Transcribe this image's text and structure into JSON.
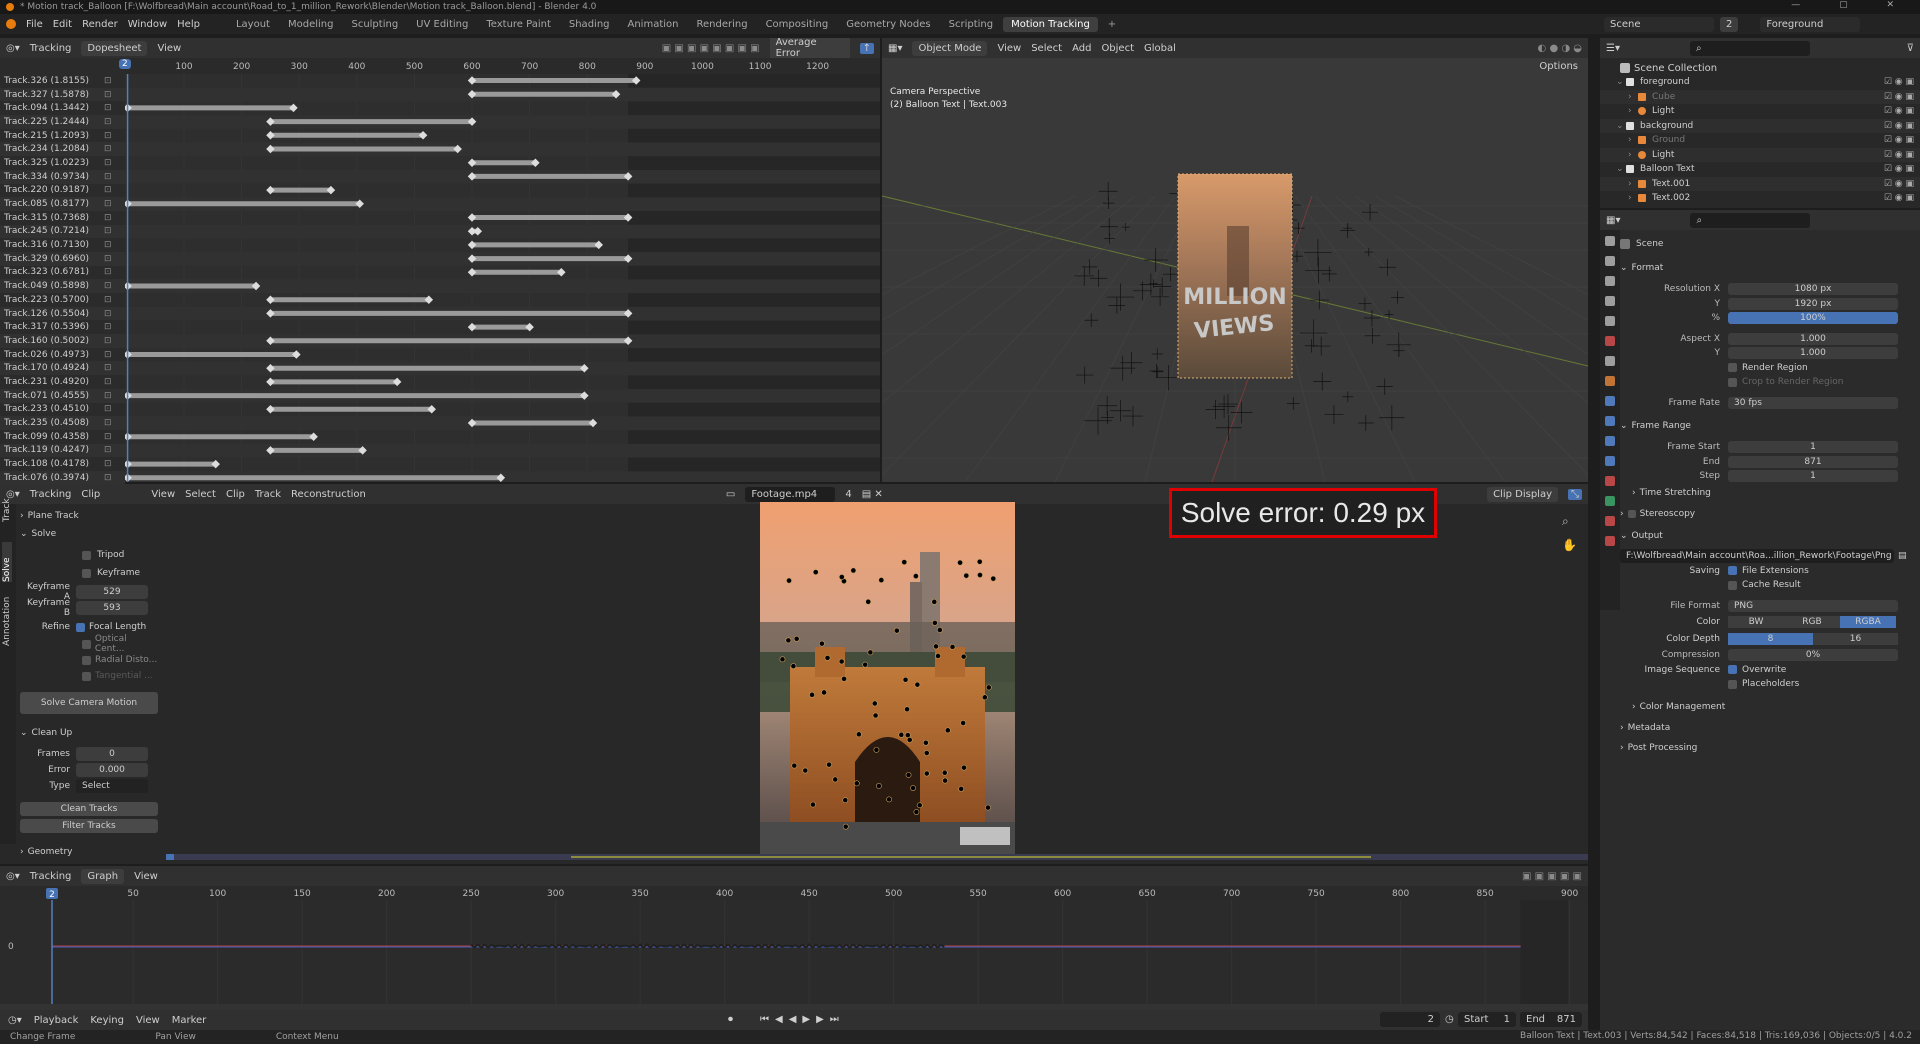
{
  "titlebar": {
    "title": "* Motion track_Balloon [F:\\Wolfbread\\Main account\\Road_to_1_million_Rework\\Blender\\Motion track_Balloon.blend] - Blender 4.0"
  },
  "menu": [
    "File",
    "Edit",
    "Render",
    "Window",
    "Help"
  ],
  "workspaces": [
    "Layout",
    "Modeling",
    "Sculpting",
    "UV Editing",
    "Texture Paint",
    "Shading",
    "Animation",
    "Rendering",
    "Compositing",
    "Geometry Nodes",
    "Scripting",
    "Motion Tracking"
  ],
  "active_workspace": "Motion Tracking",
  "scene_selector": {
    "scene": "Scene",
    "count": "2",
    "view_layer": "Foreground"
  },
  "dopesheet": {
    "mode": "Tracking",
    "view_type": "Dopesheet",
    "view_menu": "View",
    "sort": "Average Error",
    "current_frame": "2",
    "ruler": [
      "100",
      "200",
      "300",
      "400",
      "500",
      "600",
      "700",
      "800",
      "900",
      "1000",
      "1100",
      "1200"
    ],
    "tracks": [
      {
        "name": "Track.326 (1.8155)",
        "s": 600,
        "e": 885
      },
      {
        "name": "Track.327 (1.5878)",
        "s": 600,
        "e": 850
      },
      {
        "name": "Track.094 (1.3442)",
        "s": 2,
        "e": 290
      },
      {
        "name": "Track.225 (1.2444)",
        "s": 250,
        "e": 600
      },
      {
        "name": "Track.215 (1.2093)",
        "s": 250,
        "e": 515
      },
      {
        "name": "Track.234 (1.2084)",
        "s": 250,
        "e": 575
      },
      {
        "name": "Track.325 (1.0223)",
        "s": 600,
        "e": 710
      },
      {
        "name": "Track.334 (0.9734)",
        "s": 600,
        "e": 871
      },
      {
        "name": "Track.220 (0.9187)",
        "s": 250,
        "e": 355
      },
      {
        "name": "Track.085 (0.8177)",
        "s": 2,
        "e": 405
      },
      {
        "name": "Track.315 (0.7368)",
        "s": 600,
        "e": 871
      },
      {
        "name": "Track.245 (0.7214)",
        "s": 600,
        "e": 610
      },
      {
        "name": "Track.316 (0.7130)",
        "s": 600,
        "e": 820
      },
      {
        "name": "Track.329 (0.6960)",
        "s": 600,
        "e": 871
      },
      {
        "name": "Track.323 (0.6781)",
        "s": 600,
        "e": 755
      },
      {
        "name": "Track.049 (0.5898)",
        "s": 2,
        "e": 225
      },
      {
        "name": "Track.223 (0.5700)",
        "s": 250,
        "e": 525
      },
      {
        "name": "Track.126 (0.5504)",
        "s": 250,
        "e": 871
      },
      {
        "name": "Track.317 (0.5396)",
        "s": 600,
        "e": 700
      },
      {
        "name": "Track.160 (0.5002)",
        "s": 250,
        "e": 871
      },
      {
        "name": "Track.026 (0.4973)",
        "s": 2,
        "e": 295
      },
      {
        "name": "Track.170 (0.4924)",
        "s": 250,
        "e": 795
      },
      {
        "name": "Track.231 (0.4920)",
        "s": 250,
        "e": 470
      },
      {
        "name": "Track.071 (0.4555)",
        "s": 2,
        "e": 795
      },
      {
        "name": "Track.233 (0.4510)",
        "s": 250,
        "e": 530
      },
      {
        "name": "Track.235 (0.4508)",
        "s": 600,
        "e": 810
      },
      {
        "name": "Track.099 (0.4358)",
        "s": 2,
        "e": 325
      },
      {
        "name": "Track.119 (0.4247)",
        "s": 250,
        "e": 410
      },
      {
        "name": "Track.108 (0.4178)",
        "s": 2,
        "e": 155
      },
      {
        "name": "Track.076 (0.3974)",
        "s": 2,
        "e": 650
      }
    ]
  },
  "viewport": {
    "mode": "Object Mode",
    "menus": [
      "View",
      "Select",
      "Add",
      "Object"
    ],
    "transform": "Global",
    "options": "Options",
    "info_line1": "Camera Perspective",
    "info_line2": "(2) Balloon Text | Text.003",
    "text_line1": "MILLION",
    "text_line2": "VIEWS"
  },
  "clip_editor": {
    "mode": "Tracking",
    "view": "Clip",
    "menus": [
      "View",
      "Select",
      "Clip",
      "Track",
      "Reconstruction"
    ],
    "clip_name": "Footage.mp4",
    "clip_users": "4",
    "display": "Clip Display",
    "solve_error": "Solve error: 0.29 px"
  },
  "solve_panel": {
    "tabs": [
      "Track",
      "Solve",
      "Annotation"
    ],
    "plane_track": "Plane Track",
    "solve": "Solve",
    "tripod": "Tripod",
    "keyframe": "Keyframe",
    "keyframe_a_label": "Keyframe A",
    "keyframe_a": "529",
    "keyframe_b_label": "Keyframe B",
    "keyframe_b": "593",
    "refine": "Refine",
    "focal_length": "Focal Length",
    "optical_center": "Optical Cent...",
    "radial_distortion": "Radial Disto...",
    "tangential": "Tangential ...",
    "solve_button": "Solve Camera Motion",
    "clean_up": "Clean Up",
    "frames_label": "Frames",
    "frames": "0",
    "error_label": "Error",
    "error": "0.000",
    "type_label": "Type",
    "type": "Select",
    "clean_tracks": "Clean Tracks",
    "filter_tracks": "Filter Tracks",
    "geometry": "Geometry"
  },
  "graph": {
    "mode": "Tracking",
    "view_type": "Graph",
    "view_menu": "View",
    "current_frame": "2",
    "ruler": [
      "50",
      "100",
      "150",
      "200",
      "250",
      "300",
      "350",
      "400",
      "450",
      "500",
      "550",
      "600",
      "650",
      "700",
      "750",
      "800",
      "850",
      "900"
    ],
    "zero_label": "0"
  },
  "timeline": {
    "menus": [
      "Playback",
      "Keying",
      "View",
      "Marker"
    ],
    "frame": "2",
    "start_label": "Start",
    "start": "1",
    "end_label": "End",
    "end": "871"
  },
  "statusbar": {
    "hints": [
      "Change Frame",
      "Pan View",
      "Context Menu"
    ],
    "stats": "Balloon Text | Text.003 | Verts:84,542 | Faces:84,518 | Tris:169,036 | Objects:0/5 | 4.0.2"
  },
  "outliner": {
    "root": "Scene Collection",
    "items": [
      {
        "label": "foreground",
        "level": 1,
        "kind": "collection"
      },
      {
        "label": "Cube",
        "level": 2,
        "kind": "mesh",
        "dim": true
      },
      {
        "label": "Light",
        "level": 2,
        "kind": "light"
      },
      {
        "label": "background",
        "level": 1,
        "kind": "collection"
      },
      {
        "label": "Ground",
        "level": 2,
        "kind": "mesh",
        "dim": true
      },
      {
        "label": "Light",
        "level": 2,
        "kind": "light"
      },
      {
        "label": "Balloon Text",
        "level": 1,
        "kind": "collection"
      },
      {
        "label": "Text.001",
        "level": 2,
        "kind": "text"
      },
      {
        "label": "Text.002",
        "level": 2,
        "kind": "text"
      }
    ]
  },
  "properties": {
    "context": "Scene",
    "format": "Format",
    "resolution_x_label": "Resolution X",
    "resolution_x": "1080 px",
    "y_label": "Y",
    "resolution_y": "1920 px",
    "pct_label": "%",
    "pct": "100%",
    "aspect_x_label": "Aspect X",
    "aspect_x": "1.000",
    "aspect_y": "1.000",
    "render_region": "Render Region",
    "crop_region": "Crop to Render Region",
    "frame_rate_label": "Frame Rate",
    "frame_rate": "30 fps",
    "frame_range": "Frame Range",
    "frame_start_label": "Frame Start",
    "frame_start": "1",
    "end_label": "End",
    "end": "871",
    "step_label": "Step",
    "step": "1",
    "time_stretching": "Time Stretching",
    "stereoscopy": "Stereoscopy",
    "output": "Output",
    "output_path": "F:\\Wolfbread\\Main account\\Roa...illion_Rework\\Footage\\Png SEq\\",
    "saving_label": "Saving",
    "file_extensions": "File Extensions",
    "cache_result": "Cache Result",
    "file_format_label": "File Format",
    "file_format": "PNG",
    "color_label": "Color",
    "color_opts": [
      "BW",
      "RGB",
      "RGBA"
    ],
    "color_depth_label": "Color Depth",
    "depth_opts": [
      "8",
      "16"
    ],
    "compression_label": "Compression",
    "compression": "0%",
    "image_sequence_label": "Image Sequence",
    "overwrite": "Overwrite",
    "placeholders": "Placeholders",
    "color_management": "Color Management",
    "metadata": "Metadata",
    "post_processing": "Post Processing"
  },
  "colors": {
    "accent": "#4772b3",
    "highlight": "#e00000",
    "frame_line": "#5680c2"
  }
}
